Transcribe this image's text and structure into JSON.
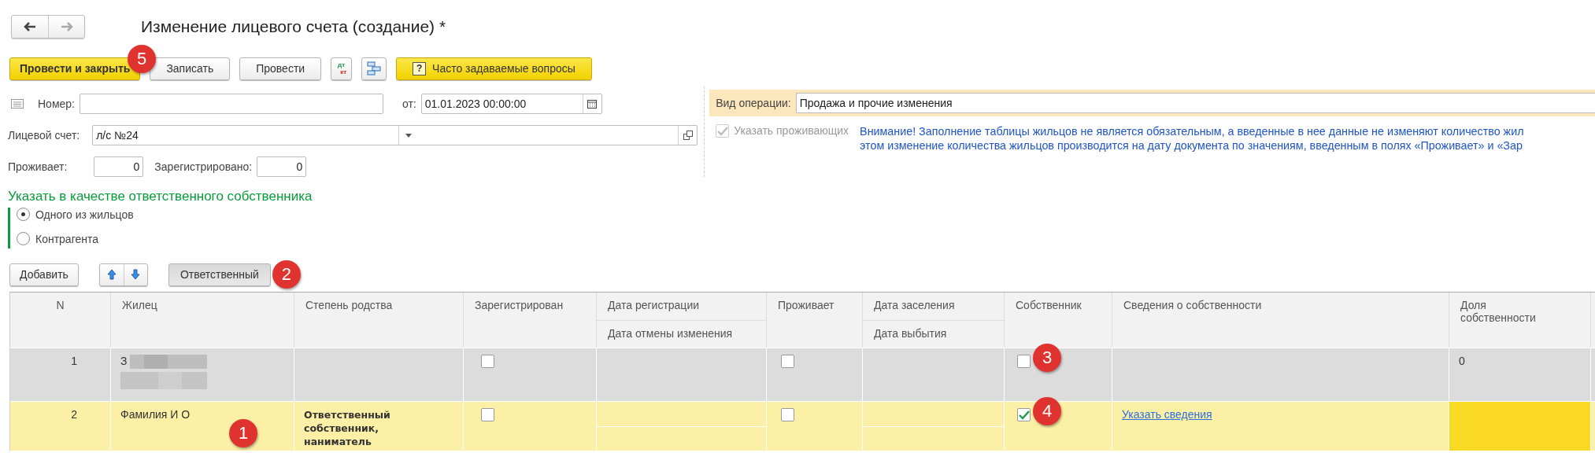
{
  "title": "Изменение лицевого счета (создание) *",
  "toolbar": [
    {
      "kind": "primary",
      "label": "Провести и закрыть",
      "marker": "5"
    },
    {
      "kind": "normal",
      "label": "Записать"
    },
    {
      "kind": "normal",
      "label": "Провести"
    },
    {
      "kind": "dtkt",
      "top": "дт",
      "bottom": "кт"
    },
    {
      "kind": "structure"
    },
    {
      "kind": "faq",
      "icon": "?",
      "label": "Часто задаваемые вопросы"
    }
  ],
  "number": {
    "label": "Номер:"
  },
  "date": {
    "label": "от:",
    "value": "01.01.2023 00:00:00"
  },
  "account": {
    "label": "Лицевой счет:",
    "value": "л/с №24"
  },
  "counts": [
    {
      "label": "Проживает:",
      "value": "0"
    },
    {
      "label": "Зарегистрировано:",
      "value": "0"
    }
  ],
  "responsible": {
    "heading": "Указать в качестве ответственного собственника",
    "options": [
      {
        "label": "Одного из жильцов",
        "selected": true
      },
      {
        "label": "Контрагента",
        "selected": false
      }
    ]
  },
  "operation": {
    "label": "Вид операции:",
    "value": "Продажа и прочие изменения"
  },
  "residents_checkbox": {
    "label": "Указать проживающих",
    "checked": true,
    "disabled": true
  },
  "notice": [
    "Внимание! Заполнение таблицы жильцов не является обязательным, а введенные в нее данные не изменяют количество жил",
    "этом изменение количества жильцов производится на дату документа по значениям, введенным в полях «Проживает» и «Зар"
  ],
  "table_toolbar": {
    "add": "Добавить",
    "responsible": {
      "label": "Ответственный",
      "pressed": true,
      "marker": "2"
    }
  },
  "table": {
    "columns": [
      {
        "label": "N"
      },
      {
        "label": "Жилец"
      },
      {
        "label": "Степень родства"
      },
      {
        "label": "Зарегистрирован"
      },
      {
        "label": "Дата регистрации",
        "sublabel": "Дата отмены изменения"
      },
      {
        "label": "Проживает"
      },
      {
        "label": "Дата заселения",
        "sublabel": "Дата выбытия"
      },
      {
        "label": "Собственник"
      },
      {
        "label": "Сведения о собственности"
      },
      {
        "label": "Доля собственности"
      }
    ],
    "rows": [
      {
        "n": "1",
        "name": "З",
        "name_redacted": true,
        "registered": false,
        "lives": false,
        "owner": false,
        "owner_marker": "3",
        "share": "0",
        "selected": false
      },
      {
        "n": "2",
        "name": "Фамилия И О",
        "name_marker": "1",
        "relation": "Ответственный собственник, наниматель",
        "registered": false,
        "lives": false,
        "owner": true,
        "owner_marker": "4",
        "info_link": "Указать сведения",
        "share_required": true,
        "selected": true
      }
    ]
  }
}
